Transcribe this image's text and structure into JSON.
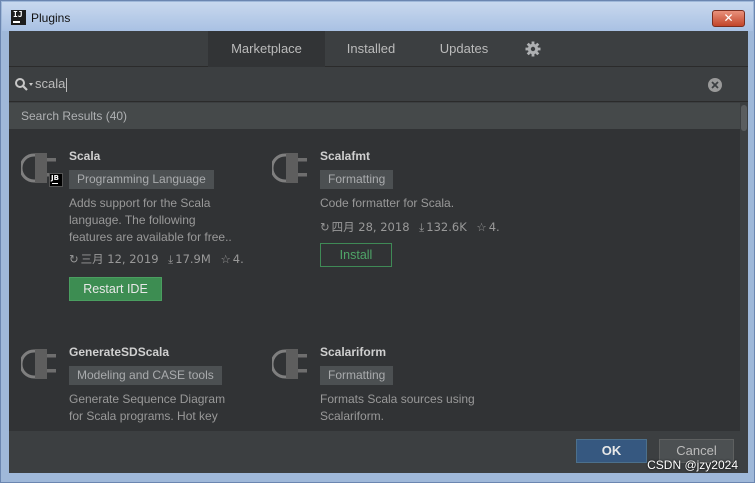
{
  "window": {
    "title": "Plugins",
    "app_icon_text": "IJ",
    "close_label": "✕"
  },
  "tabs": [
    {
      "label": "Marketplace",
      "active": true
    },
    {
      "label": "Installed",
      "active": false
    },
    {
      "label": "Updates",
      "active": false
    }
  ],
  "settings_icon": "gear-icon",
  "search": {
    "value": "scala",
    "icon": "search-icon",
    "clear_icon": "clear-icon"
  },
  "results": {
    "header": "Search Results (40)"
  },
  "plugins": [
    {
      "name": "Scala",
      "tag": "Programming Language",
      "badge": "JB",
      "description": "Adds support for the Scala\nlanguage. The following\nfeatures are available for free..",
      "date": "三月 12, 2019",
      "downloads": "17.9M",
      "rating": "4.",
      "action": "Restart IDE"
    },
    {
      "name": "Scalafmt",
      "tag": "Formatting",
      "description": "Code formatter for Scala.",
      "date": "四月 28, 2018",
      "downloads": "132.6K",
      "rating": "4.",
      "action": "Install"
    },
    {
      "name": "GenerateSDScala",
      "tag": "Modeling and CASE tools",
      "description": "Generate Sequence Diagram\nfor Scala programs. Hot key"
    },
    {
      "name": "Scalariform",
      "tag": "Formatting",
      "description": "Formats Scala sources using\nScalariform."
    }
  ],
  "footer": {
    "ok_label": "OK",
    "cancel_label": "Cancel"
  },
  "watermark": "CSDN @jzy2024",
  "colors": {
    "accent": "#365880",
    "install_green": "#3d8d52",
    "background": "#3c3f41"
  }
}
